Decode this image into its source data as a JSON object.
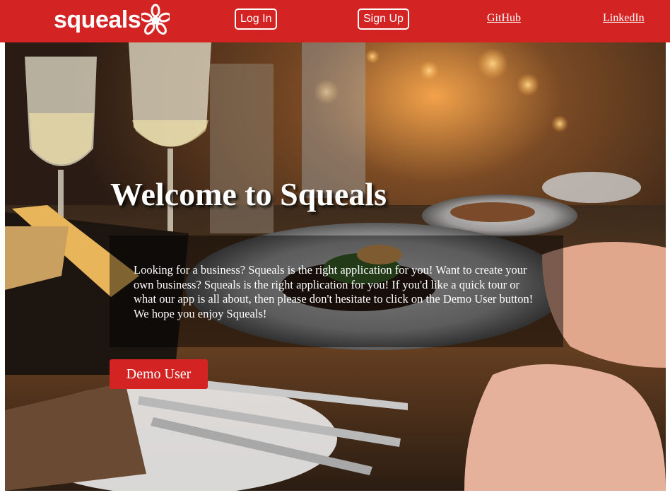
{
  "brand": {
    "name": "squeals",
    "icon": "squeals-burst-icon",
    "color": "#d32323"
  },
  "nav": {
    "login_label": "Log In",
    "signup_label": "Sign Up",
    "github_label": "GitHub",
    "linkedin_label": "LinkedIn"
  },
  "hero": {
    "title": "Welcome to Squeals",
    "description": "Looking for a business? Squeals is the right application for you! Want to create your own business? Squeals is the right application for you! If you'd like a quick tour or what our app is all about, then please don't hesitate to click on the Demo User button! We hope you enjoy Squeals!",
    "demo_button_label": "Demo User",
    "background_image": "restaurant-table-photo"
  }
}
